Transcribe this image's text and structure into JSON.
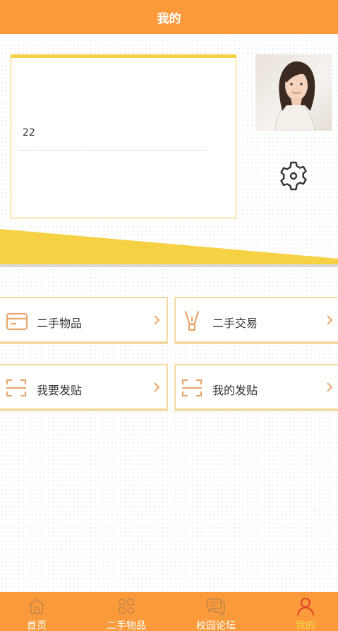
{
  "header": {
    "title": "我的"
  },
  "profile": {
    "value": "22",
    "avatar_icon": "avatar-photo",
    "settings_icon": "gear-icon"
  },
  "menu": [
    {
      "label": "二手物品",
      "icon": "card-icon"
    },
    {
      "label": "二手交易",
      "icon": "lamp-icon"
    },
    {
      "label": "我要发贴",
      "icon": "scan-frame-icon"
    },
    {
      "label": "我的发贴",
      "icon": "scan-frame-icon"
    }
  ],
  "tabbar": [
    {
      "label": "首页",
      "icon": "home-icon"
    },
    {
      "label": "二手物品",
      "icon": "grid-icon"
    },
    {
      "label": "校园论坛",
      "icon": "chat-icon"
    },
    {
      "label": "我的",
      "icon": "user-icon",
      "active": true
    }
  ],
  "colors": {
    "primary": "#fa9a3a",
    "accent_yellow": "#f7d144",
    "active_tab": "#ffd34a"
  }
}
